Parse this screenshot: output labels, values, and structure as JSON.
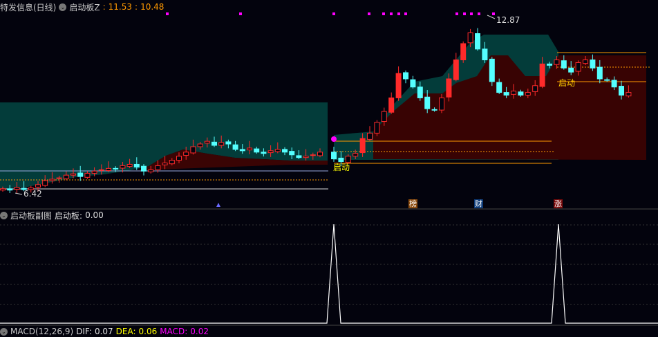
{
  "main_panel": {
    "title": "特发信息(日线)",
    "indicator_name": "启动板Z",
    "value1": "11.53",
    "value2": "10.48",
    "high_label": "12.87",
    "low_label": "6.42",
    "signal_label_1": "启动",
    "signal_label_2": "启动",
    "markers": [
      {
        "label": "榜",
        "color": "#8b4a0c"
      },
      {
        "label": "财",
        "color": "#0c3a78"
      },
      {
        "label": "涨",
        "color": "#7a0a0a"
      }
    ]
  },
  "sub_panel": {
    "title": "启动板副图",
    "indicator_label": "启动板:",
    "indicator_value": "0.00"
  },
  "macd_panel": {
    "title": "MACD(12,26,9)",
    "dif_label": "DIF:",
    "dif_value": "0.07",
    "dea_label": "DEA:",
    "dea_value": "0.06",
    "macd_label": "MACD:",
    "macd_value": "0.02"
  },
  "colors": {
    "up": "#ff2a2a",
    "down": "#54ffff",
    "accent": "#ff9900",
    "signal": "#ff00ff"
  },
  "chart_data": {
    "type": "candlestick",
    "price_range": [
      6.42,
      12.87
    ],
    "closes": [
      6.55,
      6.5,
      6.6,
      6.52,
      6.58,
      6.7,
      6.85,
      6.9,
      6.95,
      7.05,
      7.1,
      7.0,
      7.12,
      7.2,
      7.25,
      7.3,
      7.28,
      7.4,
      7.45,
      7.35,
      7.2,
      7.25,
      7.4,
      7.5,
      7.6,
      7.75,
      7.9,
      8.1,
      8.2,
      8.3,
      8.15,
      8.25,
      8.2,
      8.0,
      7.95,
      8.05,
      7.9,
      7.85,
      7.95,
      8.0,
      7.9,
      7.8,
      7.7,
      7.75,
      7.8,
      7.9,
      7.65,
      7.55,
      7.75,
      7.85,
      8.4,
      8.6,
      9.0,
      9.4,
      9.9,
      10.8,
      10.6,
      10.3,
      9.9,
      9.5,
      9.45,
      9.9,
      10.6,
      11.3,
      11.9,
      12.3,
      11.7,
      11.3,
      10.5,
      10.1,
      10.0,
      10.15,
      10.0,
      10.1,
      10.35,
      11.15,
      11.1,
      11.3,
      11.0,
      10.85,
      11.2,
      11.3,
      11.0,
      10.6,
      10.55,
      10.3,
      10.0,
      10.1
    ],
    "start_signal_indices": [
      46,
      77
    ],
    "sub_signal_peaks": [
      46,
      77
    ]
  }
}
